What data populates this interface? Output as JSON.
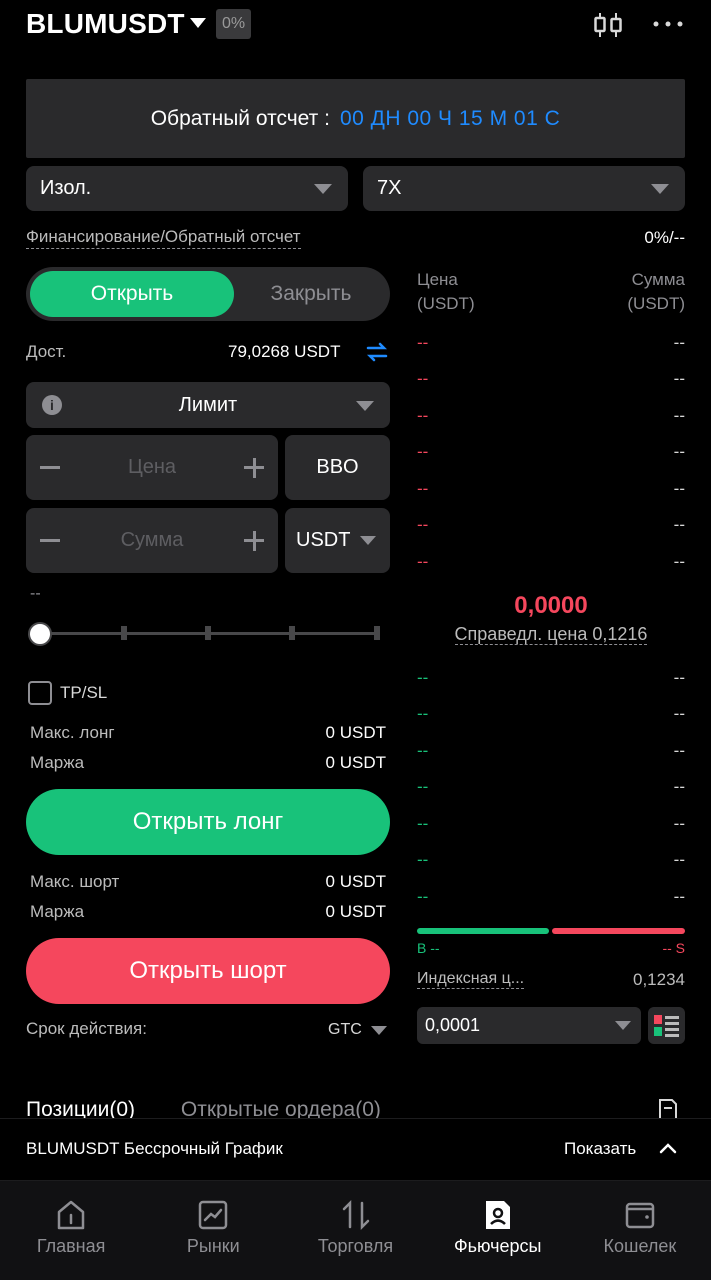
{
  "header": {
    "symbol": "BLUMUSDT",
    "change": "0%"
  },
  "countdown": {
    "label": "Обратный отсчет :",
    "value": "00 ДН 00 Ч 15 М 01 С"
  },
  "margin_mode": "Изол.",
  "leverage": "7X",
  "funding": {
    "label": "Финансирование/Обратный отсчет",
    "value": "0%/--"
  },
  "toggle": {
    "open": "Открыть",
    "close": "Закрыть"
  },
  "available": {
    "label": "Дост.",
    "value": "79,0268 USDT"
  },
  "order_type": "Лимит",
  "price_input": {
    "placeholder": "Цена",
    "side": "BBO"
  },
  "amount_input": {
    "placeholder": "Сумма",
    "unit": "USDT"
  },
  "slider_value": "--",
  "slider_percent": 0,
  "tpsl": "TP/SL",
  "long": {
    "max_label": "Макс. лонг",
    "max_value": "0 USDT",
    "margin_label": "Маржа",
    "margin_value": "0 USDT",
    "button": "Открыть лонг"
  },
  "short": {
    "max_label": "Макс. шорт",
    "max_value": "0 USDT",
    "margin_label": "Маржа",
    "margin_value": "0 USDT",
    "button": "Открыть шорт"
  },
  "time_in_force": {
    "label": "Срок действия:",
    "value": "GTC"
  },
  "orderbook": {
    "price_header": "Цена",
    "price_unit": "(USDT)",
    "amount_header": "Сумма",
    "amount_unit": "(USDT)",
    "asks": [
      [
        "--",
        "--"
      ],
      [
        "--",
        "--"
      ],
      [
        "--",
        "--"
      ],
      [
        "--",
        "--"
      ],
      [
        "--",
        "--"
      ],
      [
        "--",
        "--"
      ],
      [
        "--",
        "--"
      ]
    ],
    "last_price": "0,0000",
    "fair_price": "Справедл. цена 0,1216",
    "bids": [
      [
        "--",
        "--"
      ],
      [
        "--",
        "--"
      ],
      [
        "--",
        "--"
      ],
      [
        "--",
        "--"
      ],
      [
        "--",
        "--"
      ],
      [
        "--",
        "--"
      ],
      [
        "--",
        "--"
      ]
    ],
    "buy_label": "B --",
    "sell_label": "-- S",
    "index_label": "Индексная ц...",
    "index_value": "0,1234",
    "tick": "0,0001"
  },
  "tabs": {
    "positions": "Позиции(0)",
    "orders": "Открытые ордера(0)"
  },
  "chart_bar": {
    "title": "BLUMUSDT Бессрочный График",
    "show": "Показать"
  },
  "nav": [
    {
      "label": "Главная",
      "icon": "home-icon"
    },
    {
      "label": "Рынки",
      "icon": "chart-icon"
    },
    {
      "label": "Торговля",
      "icon": "trade-arrows-icon"
    },
    {
      "label": "Фьючерсы",
      "icon": "futures-icon",
      "active": true
    },
    {
      "label": "Кошелек",
      "icon": "wallet-icon"
    }
  ],
  "colors": {
    "green": "#18c27a",
    "red": "#f5475d",
    "blue": "#1f8bff",
    "panel": "#2a2a2c"
  }
}
